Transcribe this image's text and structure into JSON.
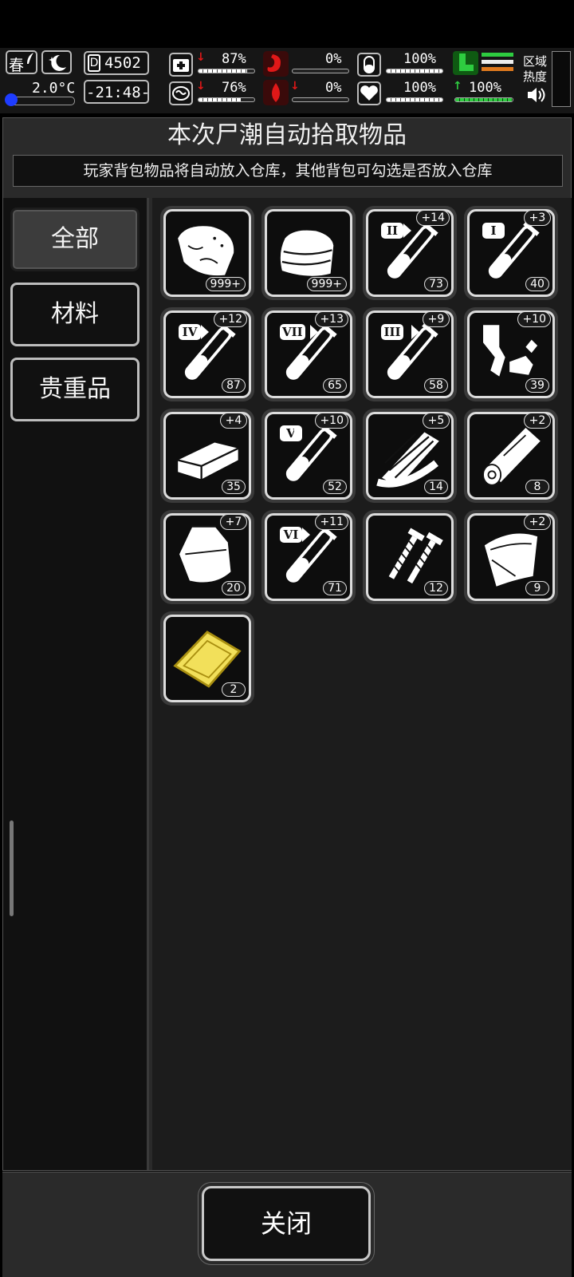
{
  "hud": {
    "season": "春",
    "temperature": "2.0°C",
    "day": "4502",
    "time": "-21:48-",
    "stats": [
      {
        "icon": "first-aid-icon",
        "value": "87%",
        "trend": "down",
        "fill": 0.87
      },
      {
        "icon": "stomach-icon",
        "value": "0%",
        "trend": "none",
        "fill": 0.0
      },
      {
        "icon": "pill-icon",
        "value": "100%",
        "trend": "none",
        "fill": 1.0
      },
      {
        "icon": "brain-icon",
        "value": "76%",
        "trend": "down",
        "fill": 0.76
      },
      {
        "icon": "blood-drop-icon",
        "value": "0%",
        "trend": "down",
        "fill": 0.0
      },
      {
        "icon": "heart-icon",
        "value": "100%",
        "trend": "none",
        "fill": 1.0
      }
    ],
    "stamina": {
      "value": "100%",
      "trend": "up",
      "fill": 1.0
    },
    "region_heat_label": "区域热度",
    "colors": {
      "accent_green": "#2ecc40",
      "accent_orange": "#e07a1e",
      "warn_red": "#e01818",
      "temp_blue": "#1e3cff"
    }
  },
  "panel": {
    "title": "本次尸潮自动拾取物品",
    "subtitle": "玩家背包物品将自动放入仓库，其他背包可勾选是否放入仓库"
  },
  "tabs": [
    {
      "label": "全部",
      "active": true
    },
    {
      "label": "材料",
      "active": false
    },
    {
      "label": "贵重品",
      "active": false
    }
  ],
  "items": [
    {
      "icon": "meat-icon",
      "count": "999+",
      "bonus": ""
    },
    {
      "icon": "cloth-icon",
      "count": "999+",
      "bonus": ""
    },
    {
      "icon": "test-tube-icon",
      "tier": "II",
      "count": "73",
      "bonus": "+14"
    },
    {
      "icon": "test-tube-icon",
      "tier": "I",
      "count": "40",
      "bonus": "+3"
    },
    {
      "icon": "test-tube-icon",
      "tier": "IV",
      "count": "87",
      "bonus": "+12"
    },
    {
      "icon": "test-tube-icon",
      "tier": "VII",
      "count": "65",
      "bonus": "+13"
    },
    {
      "icon": "test-tube-icon",
      "tier": "III",
      "count": "58",
      "bonus": "+9"
    },
    {
      "icon": "scrap-parts-icon",
      "count": "39",
      "bonus": "+10"
    },
    {
      "icon": "metal-bar-icon",
      "count": "35",
      "bonus": "+4"
    },
    {
      "icon": "test-tube-icon",
      "tier": "V",
      "count": "52",
      "bonus": "+10"
    },
    {
      "icon": "wood-planks-icon",
      "count": "14",
      "bonus": "+5"
    },
    {
      "icon": "log-icon",
      "count": "8",
      "bonus": "+2"
    },
    {
      "icon": "plastic-bag-icon",
      "count": "20",
      "bonus": "+7"
    },
    {
      "icon": "test-tube-icon",
      "tier": "VI",
      "count": "71",
      "bonus": "+11"
    },
    {
      "icon": "screws-icon",
      "count": "12",
      "bonus": ""
    },
    {
      "icon": "tarp-icon",
      "count": "9",
      "bonus": "+2"
    },
    {
      "icon": "gold-card-icon",
      "count": "2",
      "bonus": ""
    }
  ],
  "footer": {
    "close_label": "关闭"
  }
}
